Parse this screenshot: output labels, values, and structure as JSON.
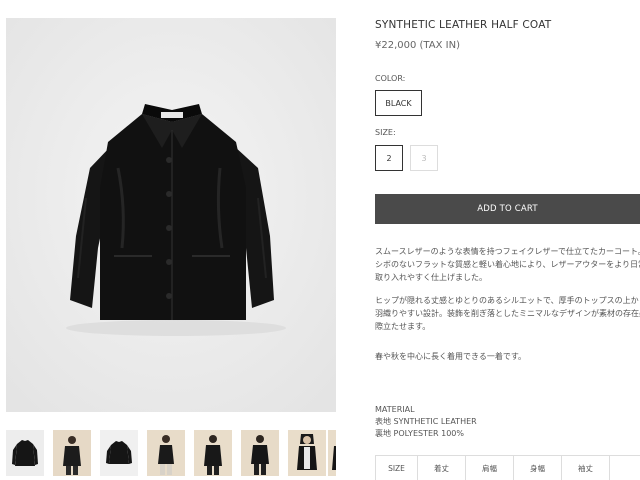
{
  "product": {
    "title": "SYNTHETIC LEATHER HALF COAT",
    "price": "¥22,000 (TAX IN)",
    "color_label": "COLOR:",
    "color_selected": "BLACK",
    "size_label": "SIZE:",
    "sizes": [
      {
        "label": "2",
        "available": true,
        "selected": true
      },
      {
        "label": "3",
        "available": false,
        "selected": false
      }
    ],
    "add_to_cart": "ADD TO CART"
  },
  "description": {
    "paragraph1": [
      "スムースレザーのような表情を持つフェイクレザーで仕立てたカーコート。",
      "シボのないフラットな質感と軽い着心地により、レザーアウターをより日常に",
      "取り入れやすく仕上げました。"
    ],
    "paragraph2": [
      "ヒップが隠れる丈感とゆとりのあるシルエットで、厚手のトップスの上からも",
      "羽織りやすい設計。装飾を削ぎ落としたミニマルなデザインが素材の存在感を",
      "際立たせます。"
    ],
    "paragraph3": "春や秋を中心に長く着用できる一着です。"
  },
  "material": {
    "label": "MATERIAL",
    "outer": "表地 SYNTHETIC LEATHER",
    "lining": "裏地 POLYESTER 100%"
  },
  "size_table": {
    "headers": [
      "SIZE",
      "着丈",
      "肩幅",
      "身幅",
      "袖丈"
    ]
  },
  "gallery": {
    "thumbnail_count": 8,
    "active_thumbnail": 1
  },
  "colors": {
    "button_dark": "#4a4a4a",
    "photo_background": "#ececec",
    "garment": "#141414"
  }
}
